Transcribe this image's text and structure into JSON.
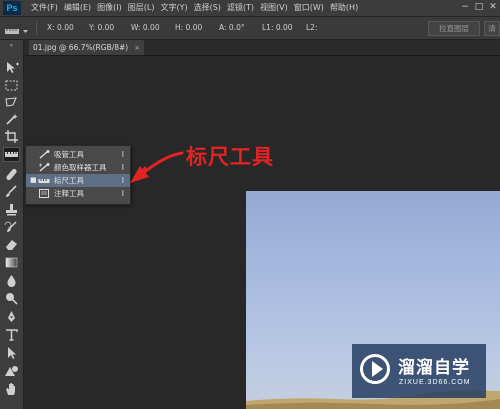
{
  "app": {
    "logo": "Ps"
  },
  "menu": [
    "文件(F)",
    "编辑(E)",
    "图像(I)",
    "图层(L)",
    "文字(Y)",
    "选择(S)",
    "滤镜(T)",
    "视图(V)",
    "窗口(W)",
    "帮助(H)"
  ],
  "window_controls": [
    "−",
    "□",
    "✕"
  ],
  "options": {
    "x": "X: 0.00",
    "y": "Y: 0.00",
    "w": "W: 0.00",
    "h": "H: 0.00",
    "a": "A: 0.0°",
    "l1": "L1: 0.00",
    "l2": "L2:",
    "straighten_button": "拉直图层",
    "clear_button": "清"
  },
  "document_tab": {
    "label": "01.jpg @ 66.7%(RGB/8#)",
    "close": "×"
  },
  "flyout": {
    "items": [
      {
        "label": "吸管工具",
        "key": "I",
        "icon": "eyedropper-icon",
        "selected": false,
        "bullet": ""
      },
      {
        "label": "颜色取样器工具",
        "key": "I",
        "icon": "color-sampler-icon",
        "selected": false,
        "bullet": ""
      },
      {
        "label": "标尺工具",
        "key": "I",
        "icon": "ruler-icon",
        "selected": true,
        "bullet": "■"
      },
      {
        "label": "注释工具",
        "key": "I",
        "icon": "note-icon",
        "selected": false,
        "bullet": ""
      }
    ]
  },
  "annotation": {
    "text": "标尺工具",
    "color": "#e02424"
  },
  "watermark": {
    "title": "溜溜自学",
    "subtitle": "ZIXUE.3D66.COM"
  },
  "toolbar": {
    "grip": "»"
  }
}
